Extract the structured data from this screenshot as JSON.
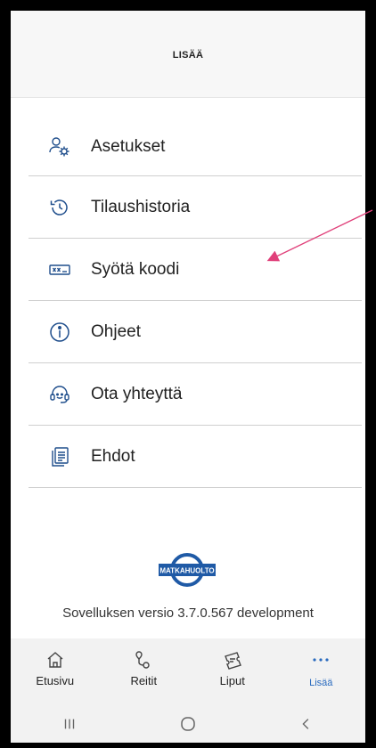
{
  "header": {
    "title": "LISÄÄ"
  },
  "menu": {
    "items": [
      {
        "label": "Asetukset",
        "icon": "settings-user-icon"
      },
      {
        "label": "Tilaushistoria",
        "icon": "history-icon"
      },
      {
        "label": "Syötä koodi",
        "icon": "code-input-icon"
      },
      {
        "label": "Ohjeet",
        "icon": "info-icon"
      },
      {
        "label": "Ota yhteyttä",
        "icon": "support-headset-icon"
      },
      {
        "label": "Ehdot",
        "icon": "documents-icon"
      }
    ]
  },
  "logo": {
    "text": "MATKAHUOLTO"
  },
  "version": {
    "text": "Sovelluksen versio 3.7.0.567  development"
  },
  "tabs": [
    {
      "label": "Etusivu",
      "icon": "home-icon"
    },
    {
      "label": "Reitit",
      "icon": "route-pin-icon"
    },
    {
      "label": "Liput",
      "icon": "ticket-icon"
    },
    {
      "label": "Lisää",
      "icon": "more-dots-icon",
      "active": true
    }
  ],
  "colors": {
    "accent": "#2a6bbf",
    "icon": "#1f4e8c",
    "annotation_arrow": "#e0407a"
  }
}
